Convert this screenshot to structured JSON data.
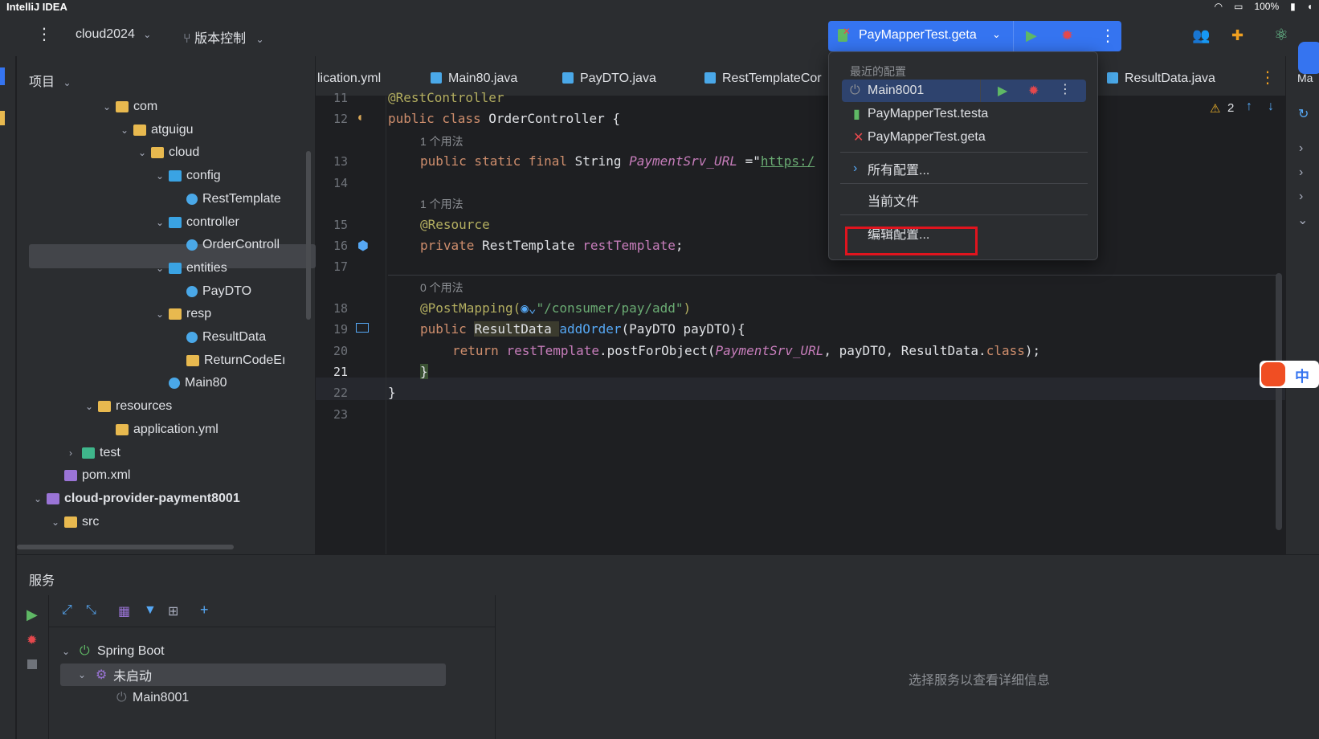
{
  "menubar": {
    "app_name": "IntelliJ IDEA",
    "battery": "100%"
  },
  "toolbar": {
    "project_name": "cloud2024",
    "vcs_label": "版本控制",
    "run_config": "PayMapperTest.geta"
  },
  "project_panel": {
    "title": "项目",
    "tree": [
      {
        "label": "com",
        "kind": "folder"
      },
      {
        "label": "atguigu",
        "kind": "folder"
      },
      {
        "label": "cloud",
        "kind": "folder"
      },
      {
        "label": "config",
        "kind": "package"
      },
      {
        "label": "RestTemplate",
        "kind": "class"
      },
      {
        "label": "controller",
        "kind": "package"
      },
      {
        "label": "OrderControll",
        "kind": "class"
      },
      {
        "label": "entities",
        "kind": "package"
      },
      {
        "label": "PayDTO",
        "kind": "class"
      },
      {
        "label": "resp",
        "kind": "folder"
      },
      {
        "label": "ResultData",
        "kind": "class"
      },
      {
        "label": "ReturnCodeEı",
        "kind": "enum"
      },
      {
        "label": "Main80",
        "kind": "class"
      },
      {
        "label": "resources",
        "kind": "folder"
      },
      {
        "label": "application.yml",
        "kind": "yaml"
      },
      {
        "label": "test",
        "kind": "test"
      },
      {
        "label": "pom.xml",
        "kind": "maven"
      },
      {
        "label": "cloud-provider-payment8001",
        "kind": "module"
      },
      {
        "label": "src",
        "kind": "folder"
      }
    ]
  },
  "tabs": [
    {
      "label": "lication.yml"
    },
    {
      "label": "Main80.java"
    },
    {
      "label": "PayDTO.java"
    },
    {
      "label": "RestTemplateCor"
    },
    {
      "label": "ResultData.java"
    },
    {
      "label": "Ma"
    }
  ],
  "editor": {
    "warnings": "2",
    "line_numbers": [
      "11",
      "12",
      "13",
      "14",
      "15",
      "16",
      "17",
      "18",
      "19",
      "20",
      "21",
      "22",
      "23"
    ],
    "hints": [
      "1 个用法",
      "1 个用法",
      "0 个用法"
    ],
    "code": {
      "l11": "@RestController",
      "l12_kw": "public class ",
      "l12_name": "OrderController {",
      "l13_kw": "public static final ",
      "l13_type": "String ",
      "l13_field": "PaymentSrv_URL",
      "l13_rest": " =\"",
      "l13_url": "https:/",
      "l15": "@Resource",
      "l16_kw": "private ",
      "l16_type": "RestTemplate ",
      "l16_field": "restTemplate",
      "l16_end": ";",
      "l18_ann": "@PostMapping(",
      "l18_str": "\"/consumer/pay/add\"",
      "l18_end": ")",
      "l19_kw": "public ",
      "l19_type": "ResultData ",
      "l19_fn": "addOrder",
      "l19_rest": "(PayDTO payDTO){",
      "l20_kw": "return ",
      "l20_field": "restTemplate",
      "l20_mid": ".postForObject(",
      "l20_c": "PaymentSrv_URL",
      "l20_rest": ", payDTO, ResultData.",
      "l20_cls": "class",
      "l20_end": ");",
      "l21": "}",
      "l22": "}"
    }
  },
  "popup": {
    "section_title": "最近的配置",
    "configs": [
      "Main8001",
      "PayMapperTest.testa",
      "PayMapperTest.geta"
    ],
    "all_configs": "所有配置...",
    "current_file": "当前文件",
    "edit_configs": "编辑配置..."
  },
  "services": {
    "title": "服务",
    "tree": [
      "Spring Boot",
      "未启动",
      "Main8001"
    ],
    "detail_placeholder": "选择服务以查看详细信息"
  },
  "ime": {
    "label": "中"
  },
  "colors": {
    "accent": "#3574f0",
    "highlight_box": "#e0141e",
    "run_green": "#5fb865",
    "debug_red": "#e5484d"
  }
}
